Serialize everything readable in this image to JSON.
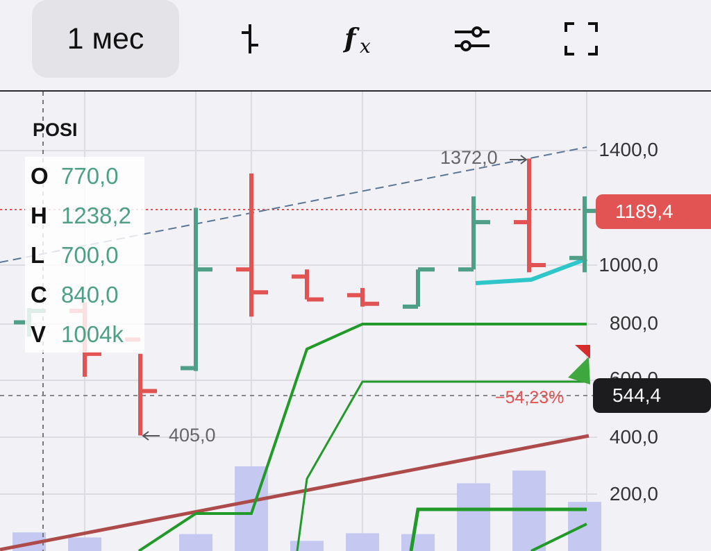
{
  "toolbar": {
    "period_label": "1 мес",
    "icons": [
      "candle-type-icon",
      "indicators-fx-icon",
      "settings-sliders-icon",
      "fullscreen-icon"
    ]
  },
  "chart": {
    "ticker": "POSI",
    "ohlc": [
      {
        "key": "O",
        "value": "770,0"
      },
      {
        "key": "H",
        "value": "1238,2"
      },
      {
        "key": "L",
        "value": "700,0"
      },
      {
        "key": "C",
        "value": "840,0"
      },
      {
        "key": "V",
        "value": "1004k"
      }
    ],
    "axis_labels": [
      "1400,0",
      "1000,0",
      "800,0",
      "600,0",
      "400,0",
      "200,0"
    ],
    "current_price": "1189,4",
    "cursor_price": "544,4",
    "change_label": "−54,23%",
    "max_label": "1372,0",
    "min_label": "405,0",
    "colors": {
      "up": "#4e9f86",
      "down": "#e25353",
      "volume": "#c5c9f2",
      "indicator_green": "#229a2a",
      "indicator_cyan": "#2ec6c9",
      "trend_brown": "#ad4b4b",
      "trend_dashed": "#5b7595"
    }
  },
  "chart_data": {
    "type": "ohlc",
    "title": "POSI",
    "period": "1 мес",
    "y_ticks": [
      200,
      400,
      600,
      800,
      1000,
      1400
    ],
    "ylim": [
      200,
      1400
    ],
    "bars": [
      {
        "o": 800,
        "h": 850,
        "l": 750,
        "c": 840,
        "up": true,
        "volume": 0.22
      },
      {
        "o": 840,
        "h": 870,
        "l": 610,
        "c": 690,
        "up": false,
        "volume": 0.16
      },
      {
        "o": 740,
        "h": 690,
        "l": 405,
        "c": 560,
        "up": false,
        "volume": 0.0
      },
      {
        "o": 640,
        "h": 1200,
        "l": 630,
        "c": 985,
        "up": true,
        "volume": 0.2
      },
      {
        "o": 985,
        "h": 1320,
        "l": 820,
        "c": 905,
        "up": false,
        "volume": 1.0
      },
      {
        "o": 960,
        "h": 985,
        "l": 880,
        "c": 880,
        "up": false,
        "volume": 0.12
      },
      {
        "o": 895,
        "h": 920,
        "l": 855,
        "c": 865,
        "up": false,
        "volume": 0.21
      },
      {
        "o": 855,
        "h": 985,
        "l": 855,
        "c": 985,
        "up": true,
        "volume": 0.2
      },
      {
        "o": 985,
        "h": 1240,
        "l": 985,
        "c": 1150,
        "up": true,
        "volume": 0.8
      },
      {
        "o": 1150,
        "h": 1372,
        "l": 975,
        "c": 1000,
        "up": false,
        "volume": 0.95
      },
      {
        "o": 1025,
        "h": 1240,
        "l": 975,
        "c": 1189.4,
        "up": true,
        "volume": 0.58
      }
    ]
  }
}
